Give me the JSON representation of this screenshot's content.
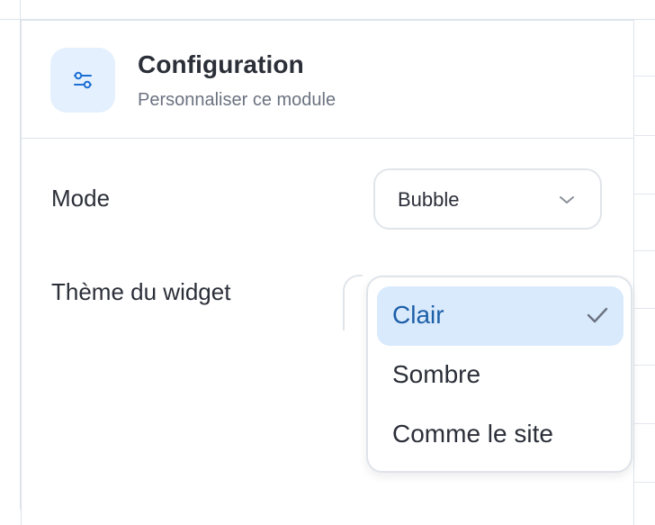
{
  "panel": {
    "title": "Configuration",
    "subtitle": "Personnaliser ce module",
    "icon": "sliders-icon"
  },
  "mode": {
    "label": "Mode",
    "value": "Bubble"
  },
  "theme": {
    "label": "Thème du widget",
    "options": [
      {
        "label": "Clair",
        "selected": true
      },
      {
        "label": "Sombre",
        "selected": false
      },
      {
        "label": "Comme le site",
        "selected": false
      }
    ]
  },
  "colors": {
    "accent": "#1d6fd6",
    "selected_bg": "#d9eafd",
    "icon_bg": "#e4f0fd"
  }
}
